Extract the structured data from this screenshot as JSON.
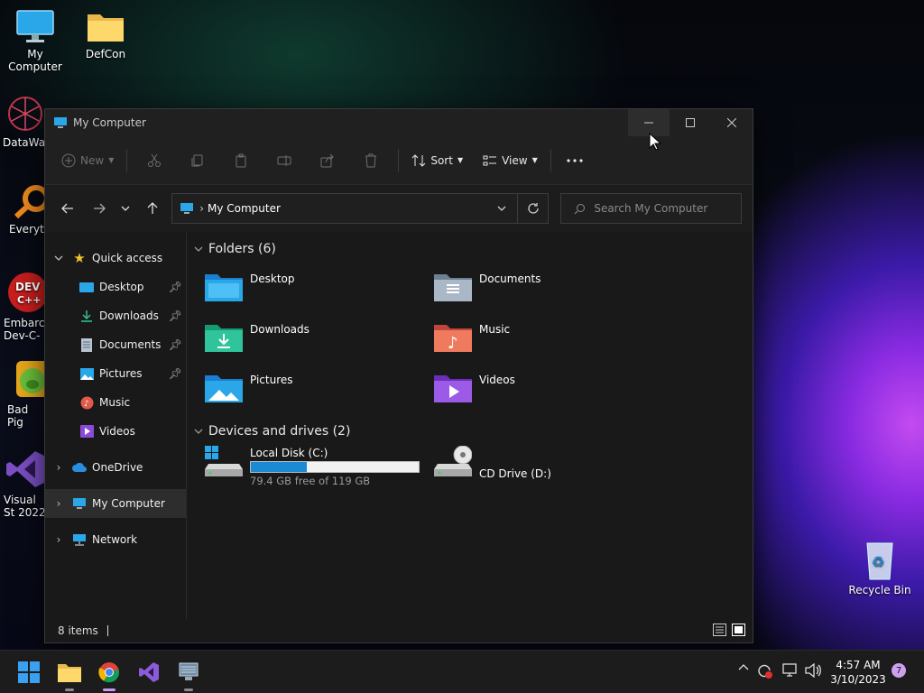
{
  "desktop": {
    "icons": [
      {
        "label": "My Computer"
      },
      {
        "label": "DefCon"
      },
      {
        "label": "DataWag"
      },
      {
        "label": "Everyth"
      },
      {
        "label": "Embarca Dev-C-"
      },
      {
        "label": "Bad Pig"
      },
      {
        "label": "Visual St 2022"
      },
      {
        "label": "Recycle Bin"
      }
    ]
  },
  "window": {
    "title": "My Computer",
    "toolbar": {
      "new_label": "New",
      "sort_label": "Sort",
      "view_label": "View"
    },
    "address": {
      "location": "My Computer",
      "search_placeholder": "Search My Computer"
    },
    "sidebar": {
      "quick_access": "Quick access",
      "items": [
        {
          "label": "Desktop"
        },
        {
          "label": "Downloads"
        },
        {
          "label": "Documents"
        },
        {
          "label": "Pictures"
        },
        {
          "label": "Music"
        },
        {
          "label": "Videos"
        }
      ],
      "onedrive": "OneDrive",
      "my_computer": "My Computer",
      "network": "Network"
    },
    "folders": {
      "header": "Folders (6)",
      "items": [
        {
          "label": "Desktop"
        },
        {
          "label": "Documents"
        },
        {
          "label": "Downloads"
        },
        {
          "label": "Music"
        },
        {
          "label": "Pictures"
        },
        {
          "label": "Videos"
        }
      ]
    },
    "devices": {
      "header": "Devices and drives (2)",
      "local_disk": {
        "label": "Local Disk (C:)",
        "free_text": "79.4 GB free of 119 GB",
        "used_fraction": 0.333
      },
      "cd_drive": {
        "label": "CD Drive (D:)"
      }
    },
    "status": {
      "items": "8 items"
    }
  },
  "taskbar": {
    "time": "4:57 AM",
    "date": "3/10/2023",
    "notifications": "7"
  },
  "colors": {
    "accent": "#1a8ad4",
    "window_bg": "#191919",
    "selection": "#2d2d2d"
  }
}
